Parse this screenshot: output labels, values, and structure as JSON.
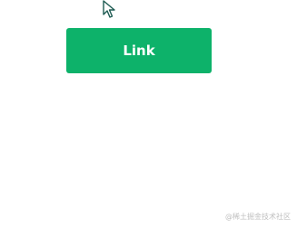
{
  "button": {
    "label": "Link",
    "color": "#0db26a",
    "text_color": "#ffffff"
  },
  "cursor": {
    "icon": "arrow-cursor-icon"
  },
  "watermark": {
    "text": "@稀土掘金技术社区"
  }
}
